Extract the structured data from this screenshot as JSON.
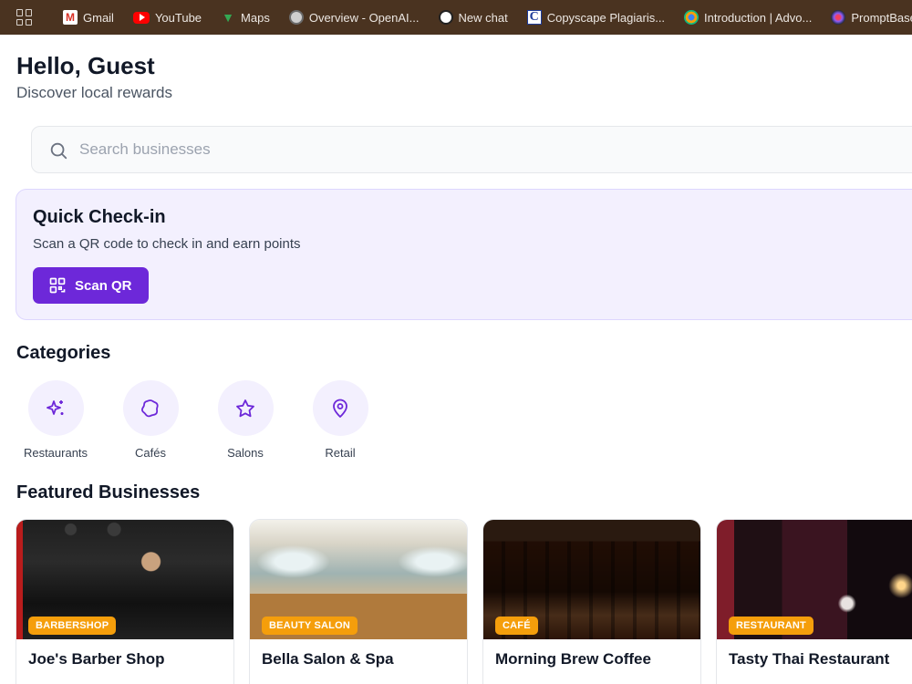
{
  "bookmarks": [
    {
      "label": "Gmail",
      "icon": "gmail-icon"
    },
    {
      "label": "YouTube",
      "icon": "youtube-icon"
    },
    {
      "label": "Maps",
      "icon": "maps-icon"
    },
    {
      "label": "Overview - OpenAI...",
      "icon": "globe-icon"
    },
    {
      "label": "New chat",
      "icon": "chatgpt-icon"
    },
    {
      "label": "Copyscape Plagiaris...",
      "icon": "copyscape-icon"
    },
    {
      "label": "Introduction | Advo...",
      "icon": "gear-icon"
    },
    {
      "label": "PromptBase",
      "icon": "promptbase-icon"
    }
  ],
  "header": {
    "greeting": "Hello, Guest",
    "subtitle": "Discover local rewards"
  },
  "search": {
    "placeholder": "Search businesses",
    "value": ""
  },
  "checkin": {
    "title": "Quick Check-in",
    "description": "Scan a QR code to check in and earn points",
    "button_label": "Scan QR"
  },
  "categories": {
    "title": "Categories",
    "items": [
      {
        "label": "Restaurants",
        "icon": "sparkles-icon"
      },
      {
        "label": "Cafés",
        "icon": "circle-icon"
      },
      {
        "label": "Salons",
        "icon": "star-icon"
      },
      {
        "label": "Retail",
        "icon": "map-pin-icon"
      }
    ]
  },
  "featured": {
    "title": "Featured Businesses",
    "items": [
      {
        "name": "Joe's Barber Shop",
        "badge": "BARBERSHOP"
      },
      {
        "name": "Bella Salon & Spa",
        "badge": "BEAUTY SALON"
      },
      {
        "name": "Morning Brew Coffee",
        "badge": "CAFÉ"
      },
      {
        "name": "Tasty Thai Restaurant",
        "badge": "RESTAURANT"
      }
    ]
  },
  "colors": {
    "accent": "#6d28d9",
    "accent_soft": "#f3f0fe",
    "badge": "#f59e0b",
    "bookmarks_bar": "#4a3320"
  }
}
